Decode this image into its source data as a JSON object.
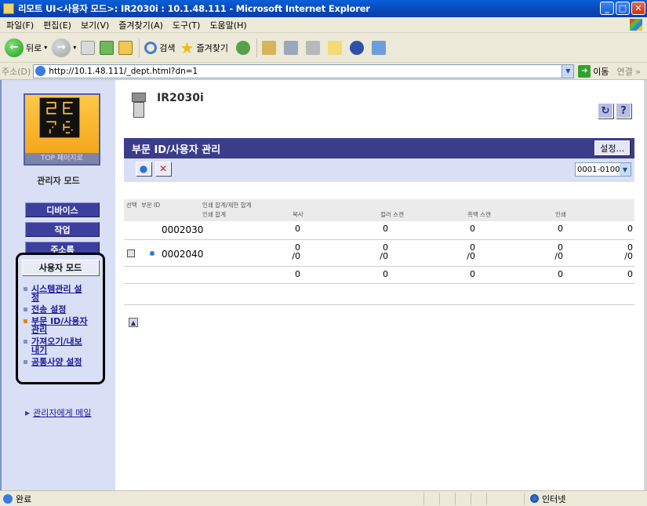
{
  "window": {
    "title": "리모트 UI<사용자 모드>: IR2030i : 10.1.48.111 - Microsoft Internet Explorer",
    "min": "_",
    "max": "□",
    "close": "✕"
  },
  "menu": [
    "파일(F)",
    "편집(E)",
    "보기(V)",
    "즐겨찾기(A)",
    "도구(T)",
    "도움말(H)"
  ],
  "toolbar": {
    "back": "뒤로",
    "search": "검색",
    "favorites": "즐겨찾기"
  },
  "address": {
    "label": "주소(D)",
    "url": "http://10.1.48.111/_dept.html?dn=1",
    "go": "이동",
    "links": "연결 »"
  },
  "sidebar": {
    "logo_label": "TOP 페이지로",
    "mode_label": "관리자 모드",
    "nav": [
      "디바이스",
      "작업",
      "주소록"
    ],
    "user_mode": "사용자 모드",
    "sublinks": [
      {
        "l1": "시스템관리 설",
        "l2": "정",
        "active": false
      },
      {
        "l1": "전송 설정",
        "l2": "",
        "active": false
      },
      {
        "l1": "부문 ID/사용자",
        "l2": "관리",
        "active": true
      },
      {
        "l1": "가져오기/내보",
        "l2": "내기",
        "active": false
      },
      {
        "l1": "공통사양 설정",
        "l2": "",
        "active": false
      }
    ],
    "mail": "관리자에게 메일"
  },
  "main": {
    "device": "IR2030i",
    "help_refresh": "↻",
    "help_q": "?",
    "section_title": "부문 ID/사용자 관리",
    "settings_btn": "설정...",
    "range": "0001-0100",
    "table": {
      "h_sel": "선택",
      "h_id": "부문 ID",
      "h_total": "인쇄 합계/제한 합계",
      "h_print": "인쇄 합계",
      "h_copy": "복사",
      "h_scan_color": "컬러 스캔",
      "h_scan_bw": "흑백 스캔",
      "h_print2": "인쇄",
      "rows": [
        {
          "id": "0002030",
          "c1": "0",
          "c2": "0",
          "c3": "0",
          "c4": "0",
          "c5": "0"
        },
        {
          "id": "0002040",
          "c1": "0",
          "c2": "0",
          "c3": "0",
          "c4": "0",
          "c5": "0",
          "s1": "/0",
          "s2": "/0",
          "s3": "/0",
          "s4": "/0",
          "s5": "/0"
        },
        {
          "id": "",
          "c1": "0",
          "c2": "0",
          "c3": "0",
          "c4": "0",
          "c5": "0"
        }
      ]
    }
  },
  "status": {
    "done": "완료",
    "zone": "인터넷"
  }
}
